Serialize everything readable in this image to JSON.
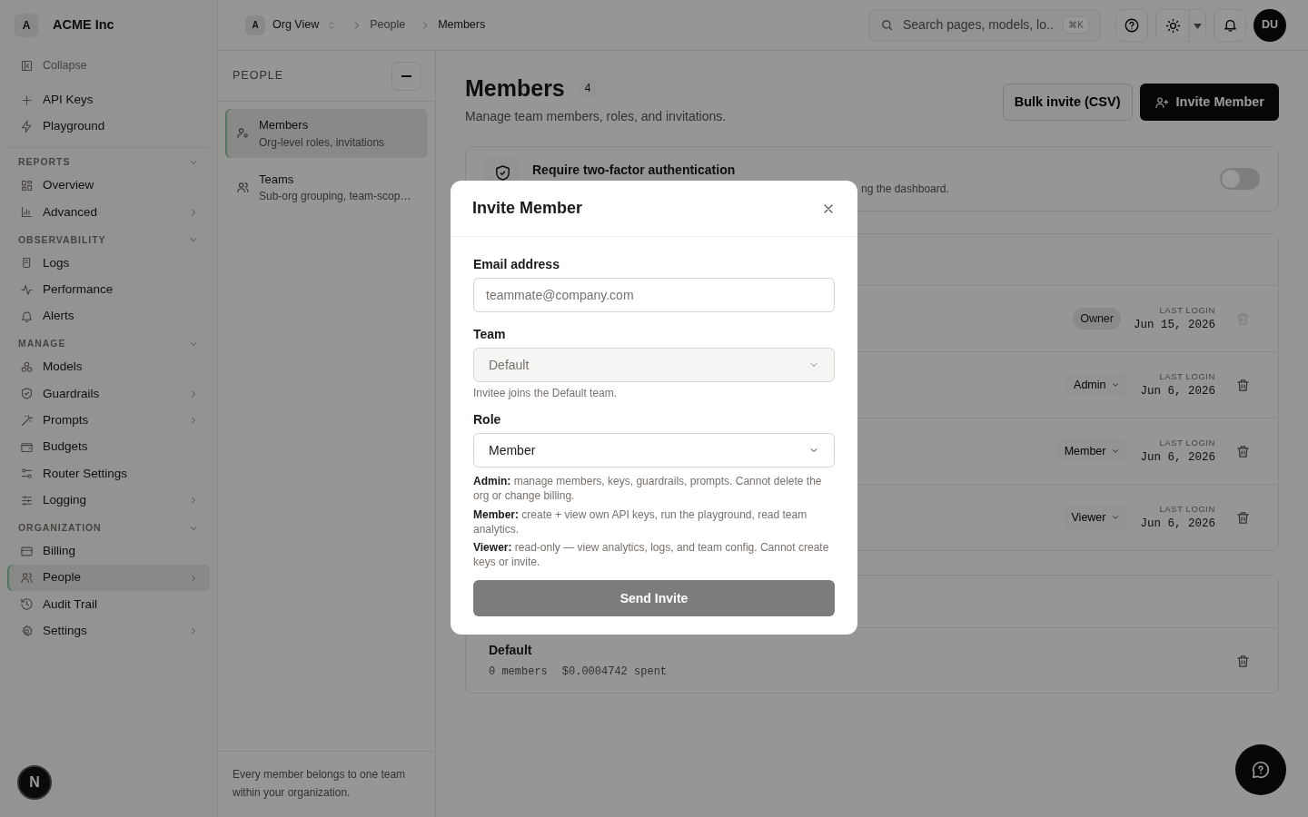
{
  "sidebar": {
    "org": {
      "initial": "A",
      "name": "ACME Inc"
    },
    "collapse": "Collapse",
    "top_items": [
      {
        "label": "API Keys",
        "selected": false
      },
      {
        "label": "Playground",
        "selected": false
      }
    ],
    "sections": [
      {
        "title": "REPORTS",
        "expanded": true,
        "items": [
          {
            "label": "Overview",
            "has_submenu": false,
            "selected": false
          },
          {
            "label": "Advanced",
            "has_submenu": true,
            "selected": false
          }
        ]
      },
      {
        "title": "OBSERVABILITY",
        "expanded": true,
        "items": [
          {
            "label": "Logs",
            "has_submenu": false,
            "selected": false
          },
          {
            "label": "Performance",
            "has_submenu": false,
            "selected": false
          },
          {
            "label": "Alerts",
            "has_submenu": false,
            "selected": false
          }
        ]
      },
      {
        "title": "MANAGE",
        "expanded": true,
        "items": [
          {
            "label": "Models",
            "has_submenu": false,
            "selected": false
          },
          {
            "label": "Guardrails",
            "has_submenu": true,
            "selected": false
          },
          {
            "label": "Prompts",
            "has_submenu": true,
            "selected": false
          },
          {
            "label": "Budgets",
            "has_submenu": false,
            "selected": false
          },
          {
            "label": "Router Settings",
            "has_submenu": false,
            "selected": false
          },
          {
            "label": "Logging",
            "has_submenu": true,
            "selected": false
          }
        ]
      },
      {
        "title": "ORGANIZATION",
        "expanded": true,
        "items": [
          {
            "label": "Billing",
            "has_submenu": false,
            "selected": false
          },
          {
            "label": "People",
            "has_submenu": true,
            "selected": true
          },
          {
            "label": "Audit Trail",
            "has_submenu": false,
            "selected": false
          },
          {
            "label": "Settings",
            "has_submenu": true,
            "selected": false
          }
        ]
      }
    ],
    "floating_badge": "N"
  },
  "topbar": {
    "breadcrumb": {
      "org_initial": "A",
      "org": "Org View",
      "items": [
        "People",
        "Members"
      ]
    },
    "search": {
      "placeholder": "Search pages, models, lo...",
      "shortcut": "⌘K"
    },
    "avatar": "DU"
  },
  "subpanel": {
    "title": "PEOPLE",
    "items": [
      {
        "label": "Members",
        "description": "Org-level roles, invitations",
        "selected": true
      },
      {
        "label": "Teams",
        "description": "Sub-org grouping, team-scop…",
        "selected": false
      }
    ],
    "footer": "Every member belongs to one team within your organization."
  },
  "page": {
    "title": "Members",
    "count": "4",
    "subtitle": "Manage team members, roles, and invitations.",
    "buttons": [
      "Bulk invite (CSV)",
      "Invite Member"
    ],
    "two_factor": {
      "title": "Require two-factor authentication",
      "description": "ng the dashboard.",
      "on": false
    },
    "members": [
      {
        "role": "Owner",
        "kind": "badge",
        "last_login_label": "LAST LOGIN",
        "date": "Jun 15, 2026",
        "deletable": false
      },
      {
        "role": "Admin",
        "kind": "dropdown",
        "last_login_label": "LAST LOGIN",
        "date": "Jun 6, 2026",
        "deletable": true
      },
      {
        "role": "Member",
        "kind": "dropdown",
        "last_login_label": "LAST LOGIN",
        "date": "Jun 6, 2026",
        "deletable": true
      },
      {
        "role": "Viewer",
        "kind": "dropdown",
        "last_login_label": "LAST LOGIN",
        "date": "Jun 6, 2026",
        "deletable": true
      }
    ],
    "teams": [
      {
        "name": "Default",
        "members": "0 members",
        "spent": "$0.0004742 spent"
      }
    ]
  },
  "modal": {
    "title": "Invite Member",
    "email": {
      "label": "Email address",
      "placeholder": "teammate@company.com"
    },
    "team": {
      "label": "Team",
      "value": "Default",
      "disabled": true,
      "help": "Invitee joins the Default team."
    },
    "role": {
      "label": "Role",
      "value": "Member"
    },
    "role_help": [
      "**Admin:** manage members, keys, guardrails, prompts. Cannot delete the org or change billing.",
      "**Member:** create + view own API keys, run the playground, read team analytics.",
      "**Viewer:** read-only — view analytics, logs, and team config. Cannot create keys or invite."
    ],
    "submit": {
      "label": "Send Invite",
      "disabled": true
    }
  }
}
